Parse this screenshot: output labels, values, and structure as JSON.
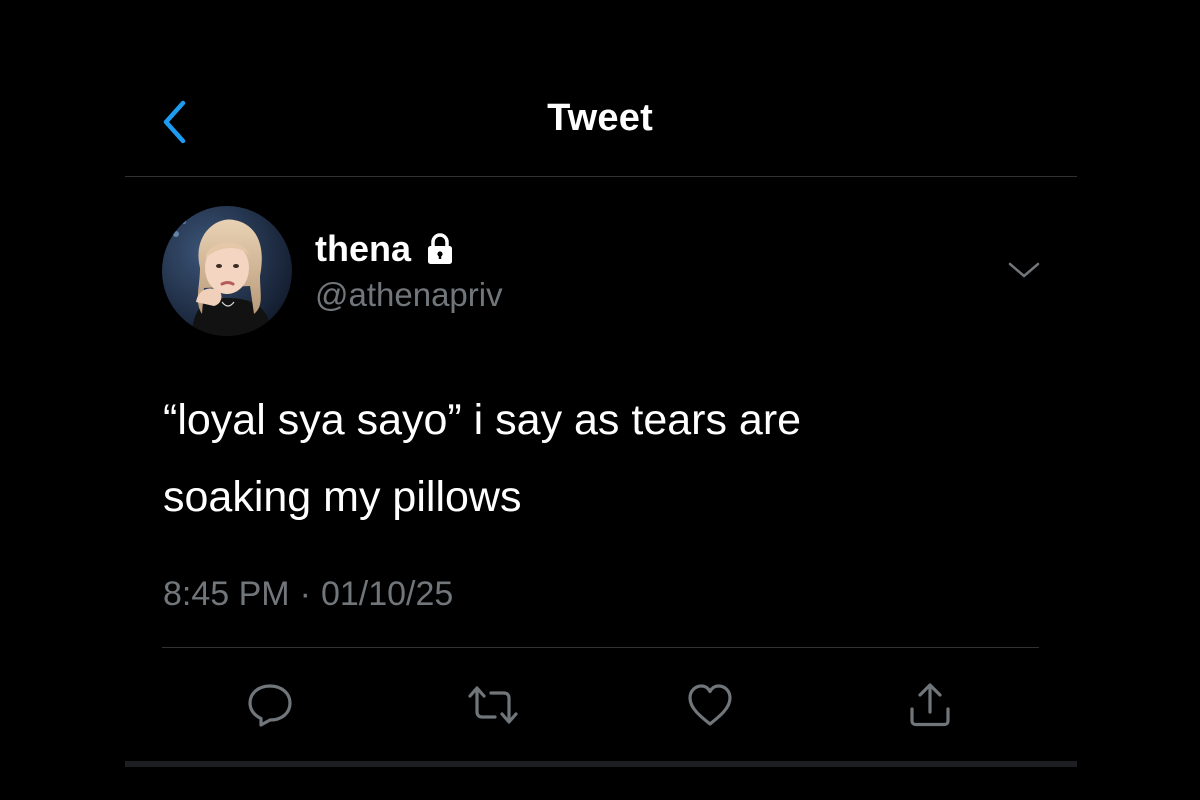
{
  "colors": {
    "background": "#000000",
    "accent": "#1d9bf0",
    "text_primary": "#ffffff",
    "text_secondary": "#71767b",
    "divider": "#2f3336"
  },
  "header": {
    "title": "Tweet",
    "back_icon": "chevron-left-icon"
  },
  "tweet": {
    "author": {
      "display_name": "thena",
      "handle": "@athenapriv",
      "protected_icon": "lock-icon",
      "avatar": "avatar-photo"
    },
    "text_line_1": "“loyal sya sayo” i say as tears are",
    "text_line_2": "soaking my pillows",
    "time": "8:45 PM",
    "separator": "·",
    "date": "01/10/25",
    "menu_icon": "chevron-down-icon"
  },
  "actions": [
    {
      "name": "reply",
      "icon": "speech-bubble-icon"
    },
    {
      "name": "retweet",
      "icon": "retweet-icon"
    },
    {
      "name": "like",
      "icon": "heart-icon"
    },
    {
      "name": "share",
      "icon": "share-icon"
    }
  ]
}
